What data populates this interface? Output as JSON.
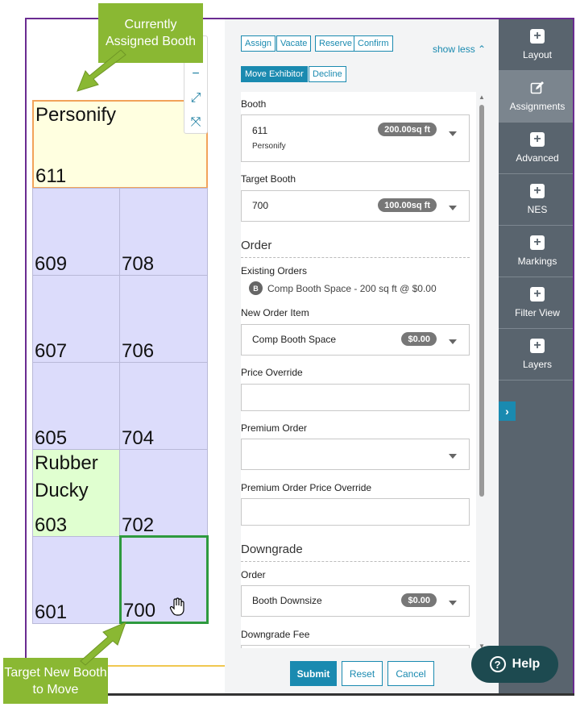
{
  "callouts": {
    "current": "Currently Assigned Booth",
    "target": "Target New Booth to Move"
  },
  "booths": [
    {
      "number": "611",
      "name": "Personify"
    },
    {
      "number": "609",
      "name": ""
    },
    {
      "number": "708",
      "name": ""
    },
    {
      "number": "607",
      "name": ""
    },
    {
      "number": "706",
      "name": ""
    },
    {
      "number": "605",
      "name": ""
    },
    {
      "number": "704",
      "name": ""
    },
    {
      "number": "603",
      "name": "Rubber Ducky"
    },
    {
      "number": "702",
      "name": ""
    },
    {
      "number": "601",
      "name": ""
    },
    {
      "number": "700",
      "name": ""
    }
  ],
  "zoom": {
    "minus": "−",
    "fit": "⤢",
    "fullscreen": "⤧"
  },
  "actions": {
    "assign": "Assign",
    "vacate": "Vacate",
    "reserve": "Reserve",
    "confirm": "Confirm",
    "show_less": "show less",
    "move_exhibitor": "Move Exhibitor",
    "decline": "Decline"
  },
  "form": {
    "booth_label": "Booth",
    "booth_value": "611",
    "booth_sub": "Personify",
    "booth_size": "200.00sq ft",
    "target_label": "Target Booth",
    "target_value": "700",
    "target_size": "100.00sq ft",
    "order_section": "Order",
    "existing_label": "Existing Orders",
    "existing_badge": "B",
    "existing_item": "Comp Booth Space - 200 sq ft @ $0.00",
    "new_item_label": "New Order Item",
    "new_item_value": "Comp Booth Space",
    "new_item_price": "$0.00",
    "price_override_label": "Price Override",
    "price_override_value": "",
    "premium_label": "Premium Order",
    "premium_value": "",
    "premium_override_label": "Premium Order Price Override",
    "premium_override_value": "",
    "downgrade_section": "Downgrade",
    "dg_order_label": "Order",
    "dg_order_value": "Booth Downsize",
    "dg_order_price": "$0.00",
    "dg_fee_label": "Downgrade Fee"
  },
  "footer": {
    "submit": "Submit",
    "reset": "Reset",
    "cancel": "Cancel"
  },
  "sidebar": {
    "items": [
      {
        "label": "Layout",
        "icon": "plus-icon"
      },
      {
        "label": "Assignments",
        "icon": "edit-icon"
      },
      {
        "label": "Advanced",
        "icon": "plus-icon"
      },
      {
        "label": "NES",
        "icon": "plus-icon"
      },
      {
        "label": "Markings",
        "icon": "plus-icon"
      },
      {
        "label": "Filter View",
        "icon": "plus-icon"
      },
      {
        "label": "Layers",
        "icon": "plus-icon"
      }
    ]
  },
  "help": {
    "label": "Help",
    "glyph": "?"
  },
  "colors": {
    "accent": "#1a8ab0",
    "sidebar": "#59646e",
    "callout": "#8ab833",
    "frame": "#6a2c91"
  }
}
